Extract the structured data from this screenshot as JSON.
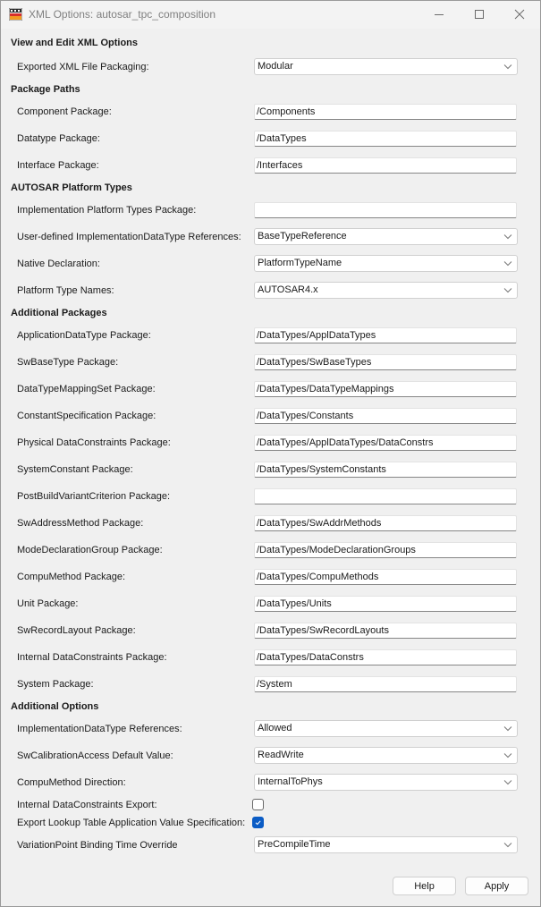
{
  "window": {
    "title": "XML Options: autosar_tpc_composition",
    "controls": {
      "minimize": "minimize",
      "maximize": "maximize",
      "close": "close"
    }
  },
  "sections": {
    "view_edit": "View and Edit XML Options",
    "package_paths": "Package Paths",
    "platform_types": "AUTOSAR Platform Types",
    "additional_packages": "Additional Packages",
    "additional_options": "Additional Options"
  },
  "fields": {
    "exported_packaging": {
      "label": "Exported XML File Packaging:",
      "value": "Modular"
    },
    "component_package": {
      "label": "Component Package:",
      "value": "/Components"
    },
    "datatype_package": {
      "label": "Datatype Package:",
      "value": "/DataTypes"
    },
    "interface_package": {
      "label": "Interface Package:",
      "value": "/Interfaces"
    },
    "impl_platform_types_package": {
      "label": "Implementation Platform Types Package:",
      "value": ""
    },
    "user_defined_impl_refs": {
      "label": "User-defined ImplementationDataType References:",
      "value": "BaseTypeReference"
    },
    "native_declaration": {
      "label": "Native Declaration:",
      "value": "PlatformTypeName"
    },
    "platform_type_names": {
      "label": "Platform Type Names:",
      "value": "AUTOSAR4.x"
    },
    "application_datatype_package": {
      "label": "ApplicationDataType Package:",
      "value": "/DataTypes/ApplDataTypes"
    },
    "swbasetype_package": {
      "label": "SwBaseType Package:",
      "value": "/DataTypes/SwBaseTypes"
    },
    "datatypemappingset_package": {
      "label": "DataTypeMappingSet Package:",
      "value": "/DataTypes/DataTypeMappings"
    },
    "constantspecification_package": {
      "label": "ConstantSpecification Package:",
      "value": "/DataTypes/Constants"
    },
    "physical_dataconstraints_package": {
      "label": "Physical DataConstraints Package:",
      "value": "/DataTypes/ApplDataTypes/DataConstrs"
    },
    "systemconstant_package": {
      "label": "SystemConstant Package:",
      "value": "/DataTypes/SystemConstants"
    },
    "postbuildvariantcriterion_package": {
      "label": "PostBuildVariantCriterion Package:",
      "value": ""
    },
    "swaddressmethod_package": {
      "label": "SwAddressMethod Package:",
      "value": "/DataTypes/SwAddrMethods"
    },
    "modedeclarationgroup_package": {
      "label": "ModeDeclarationGroup Package:",
      "value": "/DataTypes/ModeDeclarationGroups"
    },
    "compumethod_package": {
      "label": "CompuMethod Package:",
      "value": "/DataTypes/CompuMethods"
    },
    "unit_package": {
      "label": "Unit Package:",
      "value": "/DataTypes/Units"
    },
    "swrecordlayout_package": {
      "label": "SwRecordLayout Package:",
      "value": "/DataTypes/SwRecordLayouts"
    },
    "internal_dataconstraints_package": {
      "label": "Internal DataConstraints Package:",
      "value": "/DataTypes/DataConstrs"
    },
    "system_package": {
      "label": "System Package:",
      "value": "/System"
    },
    "impl_datatype_references": {
      "label": "ImplementationDataType References:",
      "value": "Allowed"
    },
    "swcalibrationaccess_default": {
      "label": "SwCalibrationAccess Default Value:",
      "value": "ReadWrite"
    },
    "compumethod_direction": {
      "label": "CompuMethod Direction:",
      "value": "InternalToPhys"
    },
    "internal_dataconstraints_export": {
      "label": "Internal DataConstraints Export:",
      "checked": false
    },
    "export_lookup_table": {
      "label": "Export Lookup Table Application Value Specification:",
      "checked": true
    },
    "variationpoint_binding_time": {
      "label": "VariationPoint Binding Time Override",
      "value": "PreCompileTime"
    }
  },
  "buttons": {
    "help": "Help",
    "apply": "Apply"
  },
  "colors": {
    "accent": "#0b5cc5",
    "background": "#f0f0f0"
  }
}
